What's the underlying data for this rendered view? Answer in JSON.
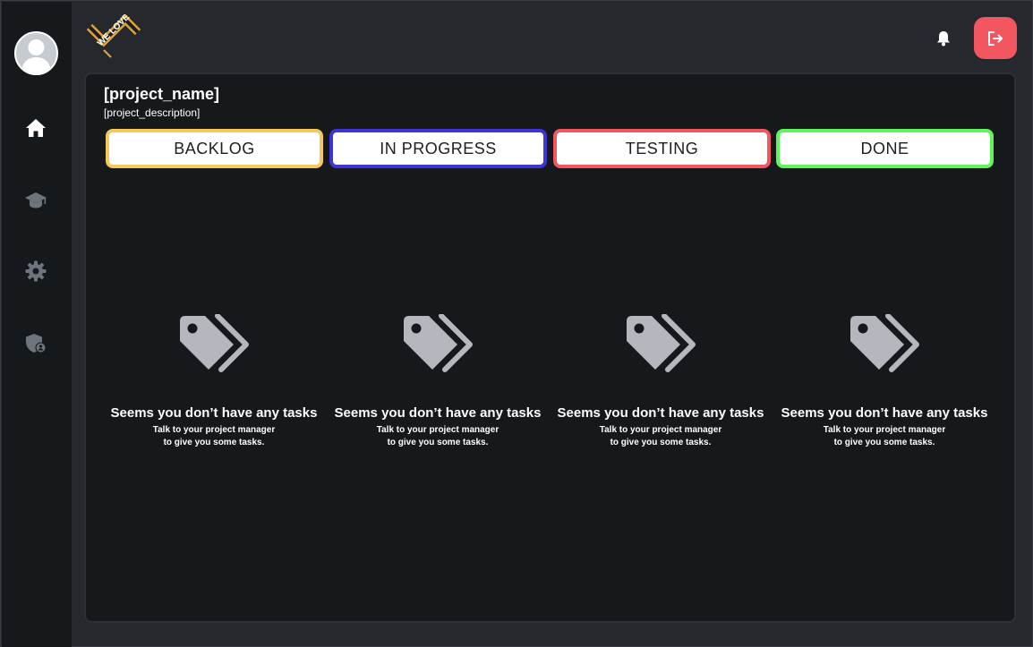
{
  "header": {
    "logo_alt": "WE LOVE",
    "notifications_icon": "bell-icon",
    "logout_icon": "logout-icon"
  },
  "sidebar": {
    "items": [
      {
        "name": "home",
        "icon": "home-icon"
      },
      {
        "name": "learning",
        "icon": "graduation-cap-icon"
      },
      {
        "name": "settings",
        "icon": "gear-icon"
      },
      {
        "name": "admin",
        "icon": "shield-user-icon"
      }
    ]
  },
  "project": {
    "name": "[project_name]",
    "description": "[project_description]"
  },
  "columns": [
    {
      "label": "BACKLOG",
      "border_color": "#f5c85a",
      "empty_title": "Seems you don’t have any tasks",
      "empty_line1": "Talk to your project manager",
      "empty_line2": "to give you some tasks."
    },
    {
      "label": "IN PROGRESS",
      "border_color": "#3d36d4",
      "empty_title": "Seems you don’t have any tasks",
      "empty_line1": "Talk to your project manager",
      "empty_line2": "to give you some tasks."
    },
    {
      "label": "TESTING",
      "border_color": "#f2565f",
      "empty_title": "Seems you don’t have any tasks",
      "empty_line1": "Talk to your project manager",
      "empty_line2": "to give you some tasks."
    },
    {
      "label": "DONE",
      "border_color": "#5ff55a",
      "empty_title": "Seems you don’t have any tasks",
      "empty_line1": "Talk to your project manager",
      "empty_line2": "to give you some tasks."
    }
  ],
  "colors": {
    "background": "#25282c",
    "sidebar": "#16191c",
    "panel": "#16191c",
    "accent_logout": "#f2565f",
    "icon_gray": "#b4b8be",
    "nav_icon_gray": "#6e747c"
  }
}
